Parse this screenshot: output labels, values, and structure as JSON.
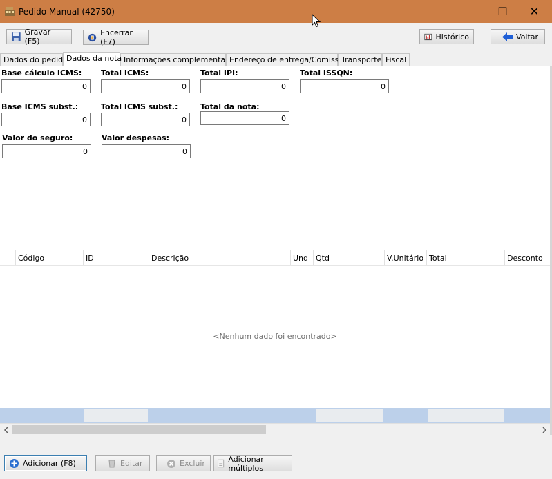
{
  "window": {
    "title": "Pedido Manual (42750)",
    "minimize": "—",
    "maximize": "☐",
    "close": "✕"
  },
  "toolbar": {
    "save_label": "Gravar (F5)",
    "close_label": "Encerrar (F7)",
    "history_label": "Histórico",
    "back_label": "Voltar"
  },
  "tabs": [
    {
      "label": "Dados do pedido"
    },
    {
      "label": "Dados da nota"
    },
    {
      "label": "Informações complementares"
    },
    {
      "label": "Endereço de entrega/Comissão"
    },
    {
      "label": "Transporte"
    },
    {
      "label": "Fiscal"
    }
  ],
  "form": {
    "base_icms": {
      "label": "Base cálculo ICMS:",
      "value": "0"
    },
    "total_icms": {
      "label": "Total ICMS:",
      "value": "0"
    },
    "total_ipi": {
      "label": "Total IPI:",
      "value": "0"
    },
    "total_issqn": {
      "label": "Total ISSQN:",
      "value": "0"
    },
    "base_icms_subst": {
      "label": "Base ICMS subst.:",
      "value": "0"
    },
    "total_icms_subst": {
      "label": "Total ICMS subst.:",
      "value": "0"
    },
    "total_nota": {
      "label": "Total da nota:",
      "value": "0"
    },
    "valor_seguro": {
      "label": "Valor do seguro:",
      "value": "0"
    },
    "valor_despesas": {
      "label": "Valor despesas:",
      "value": "0"
    }
  },
  "grid": {
    "columns": [
      "Código",
      "ID",
      "Descrição",
      "Und",
      "Qtd",
      "V.Unitário",
      "Total",
      "Desconto"
    ],
    "empty_message": "<Nenhum dado foi encontrado>"
  },
  "bottom_buttons": {
    "add_label": "Adicionar (F8)",
    "edit_label": "Editar",
    "delete_label": "Excluir",
    "add_multiple_label": "Adicionar múltiplos"
  },
  "colors": {
    "titlebar": "#cd7e45",
    "grid_footer": "#bcd0ea"
  }
}
